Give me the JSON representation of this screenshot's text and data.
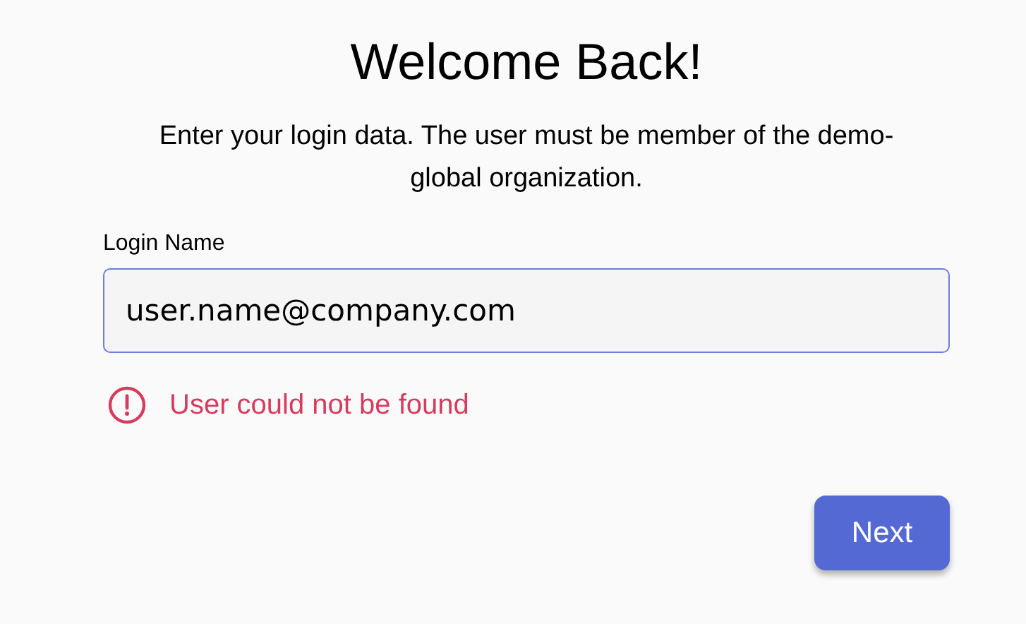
{
  "title": "Welcome Back!",
  "description": "Enter your login data. The user must be member of the demo-global organization.",
  "login_field": {
    "label": "Login Name",
    "value": "user.name@company.com",
    "focused": true
  },
  "error": {
    "message": "User could not be found"
  },
  "buttons": [
    {
      "label": "Next",
      "kind": "primary"
    }
  ]
}
